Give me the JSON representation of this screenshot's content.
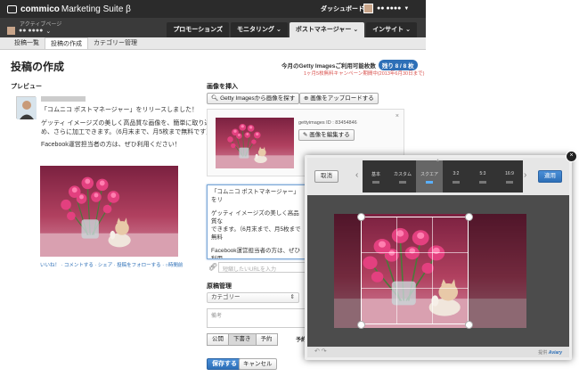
{
  "header": {
    "brand_bold": "commico",
    "brand_rest": "Marketing Suite β",
    "dashboard": "ダッシュボード",
    "user_name": "●● ●●●●"
  },
  "subheader": {
    "active_page_label": "アクティブページ",
    "account_name": "●● ●●●●",
    "nav": [
      "プロモーションズ",
      "モニタリング ⌄",
      "ポストマネージャー ⌄",
      "インサイト ⌄"
    ]
  },
  "subnav": [
    "投稿一覧",
    "投稿の作成",
    "カテゴリー管理"
  ],
  "page": {
    "title": "投稿の作成",
    "getty_label": "今月のGetty Imagesご利用可能枚数",
    "getty_badge": "残り 8 / 8 枚",
    "campaign": "1ヶ月5枚無料キャンペーン期間中(2013年6月30日まで)"
  },
  "preview": {
    "label": "プレビュー",
    "line1": "「コムニコ ポストマネージャー」をリリースしました！",
    "line2": "ゲッティ イメージズの美しく高品質な画像を、簡単に取り込",
    "line3": "め、さらに加工できます。（6月末まで、月5枚まで無料です）",
    "line4": "Facebook運営担当者の方は、ぜひ利用ください！",
    "footer": "いいね！ · コメントする · シェア · 投稿をフォローする · ○時間前"
  },
  "insert": {
    "label": "画像を挿入",
    "getty_btn": "Getty Imagesから画像を探す",
    "upload_btn": "画像をアップロードする",
    "image_id": "gettyimages ID : 83454846",
    "edit_btn": "画像を編集する",
    "close": "×"
  },
  "compose": {
    "line1": "「コムニコ ポストマネージャー」をリ",
    "line2": "ゲッティ イメージズの美しく高品質な",
    "line3": "できます。（6月末まで、月5枚まで無料",
    "line4": "Facebook運営担当者の方は、ぜひ利用",
    "url_placeholder": "短縮したいURLを入力"
  },
  "manage": {
    "label": "原稿管理",
    "category": "カテゴリー",
    "note_placeholder": "備考",
    "status_options": [
      "公開",
      "下書き",
      "予約"
    ],
    "schedule_label": "予約日時",
    "save": "保存する",
    "cancel": "キャンセル"
  },
  "editor": {
    "cancel": "取消",
    "apply": "適用",
    "ratios": [
      "基本",
      "カスタム",
      "スクエア",
      "3:2",
      "5:3",
      "16:9"
    ],
    "active_ratio": "スクエア",
    "powered_by": "提供",
    "brand": "Aviary",
    "close": "×"
  },
  "colors": {
    "accent": "#2d6fb7",
    "campaign_red": "#d9534f",
    "topbar": "#2b2b2b"
  }
}
